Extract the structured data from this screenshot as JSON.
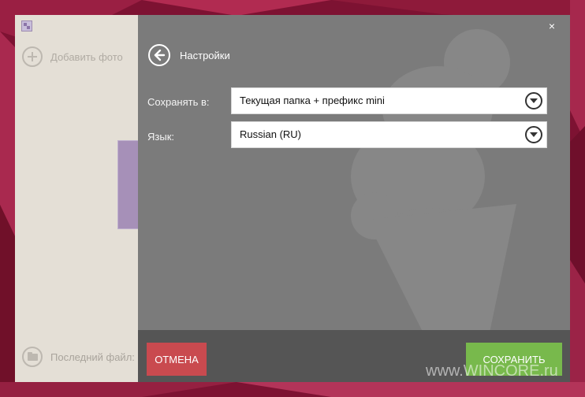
{
  "desktop": {
    "watermark": "www.WINCORE.ru"
  },
  "app": {
    "left_panel": {
      "add_photo_label": "Добавить фото",
      "last_file_label": "Последний файл:"
    },
    "settings": {
      "title": "Настройки",
      "close_glyph": "×",
      "save_to_label": "Сохранять в:",
      "save_to_value": "Текущая папка + префикс mini",
      "language_label": "Язык:",
      "language_value": "Russian (RU)"
    },
    "footer": {
      "cancel_label": "ОТМЕНА",
      "save_label": "СОХРАНИТЬ"
    }
  },
  "colors": {
    "settings_bg": "#7b7b7b",
    "footer_bg": "#555555",
    "cancel_bg": "#c94a4f",
    "save_bg": "#78b94c",
    "left_panel_bg": "#e4dfd6"
  }
}
